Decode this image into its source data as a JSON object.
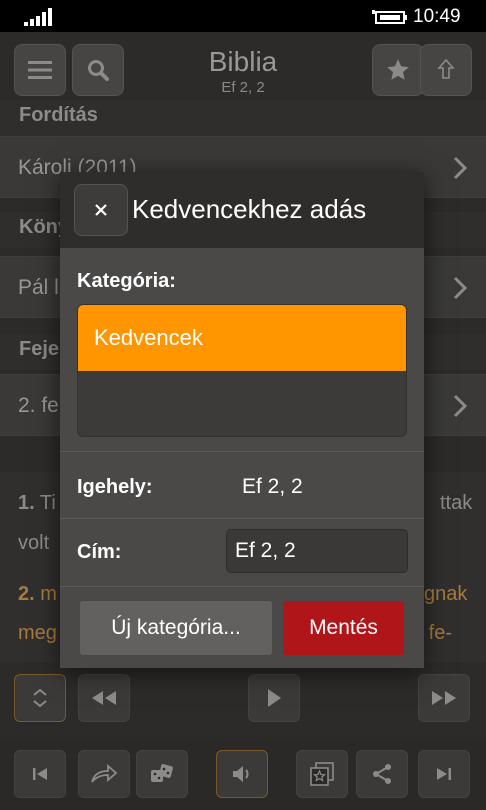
{
  "status": {
    "time": "10:49"
  },
  "header": {
    "title": "Biblia",
    "subtitle": "Ef 2, 2",
    "icons": [
      "hamburger-icon",
      "search-icon",
      "star-icon",
      "share-up-icon"
    ]
  },
  "sections": [
    {
      "heading": "Fordítás",
      "value": "Károli (2011)"
    },
    {
      "heading": "Köny",
      "value": "Pál l"
    },
    {
      "heading": "Feje",
      "value": "2. fe"
    }
  ],
  "verses": {
    "line1_num": "1.",
    "line1_text": " Ti",
    "line1_right": "ttak",
    "line2_text": "volt",
    "line3_num": "2.",
    "line3_text": " m",
    "line3_right": "gnak",
    "line4_text": "meg",
    "line4_right": "g fe-"
  },
  "modal": {
    "title": "Kedvencekhez adás",
    "category_label": "Kategória:",
    "categories": [
      "Kedvencek"
    ],
    "passage_label": "Igehely:",
    "passage_value": "Ef 2, 2",
    "title_label": "Cím:",
    "title_value": "Ef 2, 2",
    "new_category_button": "Új kategória...",
    "save_button": "Mentés"
  },
  "colors": {
    "accent": "#ff9600",
    "save": "#b0151a",
    "background": "#3a3938"
  }
}
